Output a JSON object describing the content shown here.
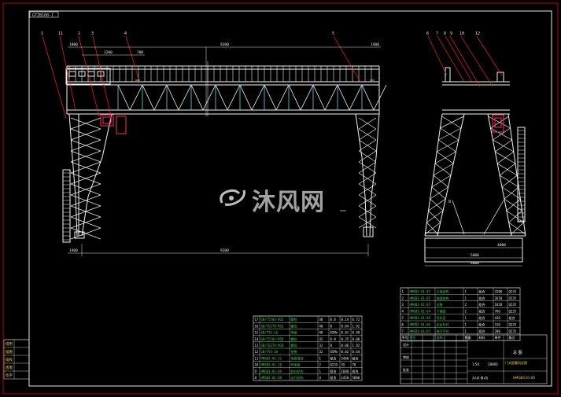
{
  "drawing": {
    "code": "GTZB100-1",
    "watermark_text": "沐风网",
    "front_view": {
      "balloons": [
        "1",
        "11",
        "2",
        "3",
        "4",
        "5"
      ],
      "dim_top_main": "9200",
      "dim_top_left": "3200",
      "dim_top_left2": "700",
      "dim_top_right": "1400",
      "dim_bottom_main": "9200",
      "dim_bottom_left": "1400",
      "dim_left_a": "1000"
    },
    "side_view": {
      "balloons": [
        "6",
        "7",
        "8",
        "9",
        "10",
        "12"
      ],
      "label_center": "8",
      "dim_1": "4000",
      "dim_2": "5000",
      "dim_3": "6000"
    },
    "parts_table_upper": {
      "rows": [
        [
          "1",
          "HMGB3-01-01",
          "主梁结构",
          "1",
          "组合",
          "3200",
          "Q235"
        ],
        [
          "2",
          "HMGB3-01-02",
          "端梁结构",
          "1",
          "组合",
          "2610",
          "Q235"
        ],
        [
          "3",
          "HMGB3-01-03",
          "支腿",
          "2",
          "组合",
          "1820",
          "Q235"
        ],
        [
          "4",
          "HMGB3-01-04",
          "下横梁",
          "2",
          "组合",
          "760",
          "Q235"
        ],
        [
          "5",
          "HMGB3-01-05",
          "司机室",
          "1",
          "组合",
          "420",
          "组合"
        ],
        [
          "6",
          "HMGB3-01-06",
          "走台栏杆",
          "1",
          "组合",
          "310",
          "Q235"
        ],
        [
          "7",
          "HMGB3-01-07",
          "梯子平台",
          "1",
          "组合",
          "280",
          "Q235"
        ]
      ],
      "header": [
        "序号",
        "代号",
        "名称",
        "数量",
        "材料",
        "单件",
        "备注"
      ]
    },
    "parts_table_lower": {
      "rows": [
        [
          "17",
          "GB/T5783-M16",
          "螺栓",
          "48",
          "8.8",
          "0.14",
          "6.72"
        ],
        [
          "16",
          "GB/T6170-M16",
          "螺母",
          "48",
          "8",
          "0.04",
          "1.92"
        ],
        [
          "15",
          "GB/T93-16",
          "垫圈",
          "48",
          "65Mn",
          "0.01",
          "0.48"
        ],
        [
          "14",
          "GB/T5783-M20",
          "螺栓",
          "32",
          "8.8",
          "0.25",
          "8.00"
        ],
        [
          "13",
          "GB/T6170-M20",
          "螺母",
          "32",
          "8",
          "0.06",
          "1.92"
        ],
        [
          "12",
          "GB/T93-20",
          "垫圈",
          "32",
          "65Mn",
          "0.02",
          "0.64"
        ],
        [
          "11",
          "HMGB3-01-11",
          "电缆滑线",
          "1",
          "组合",
          "2400",
          "组合"
        ],
        [
          "10",
          "HMGB3-01-10",
          "导电架",
          "2",
          "Q235",
          "35",
          "70"
        ],
        [
          "9",
          "HMGB3-01-09",
          "起升机构",
          "1",
          "组合",
          "1600",
          "组合"
        ],
        [
          "8",
          "HMGB3-01-08",
          "运行机构",
          "4",
          "组合",
          "1450",
          "5800"
        ]
      ]
    },
    "title_block": {
      "product_name": "门式起重机总图",
      "drawing_no": "HMGB3-01-00",
      "scale": "1:50",
      "sheet": "共1张 第1张",
      "designer": "设计",
      "checker": "审核",
      "approver": "批准",
      "weight": "28800",
      "company": "总  图"
    },
    "left_margin_cells": [
      "借用",
      "描图",
      "描校",
      "底图",
      "签字"
    ]
  }
}
